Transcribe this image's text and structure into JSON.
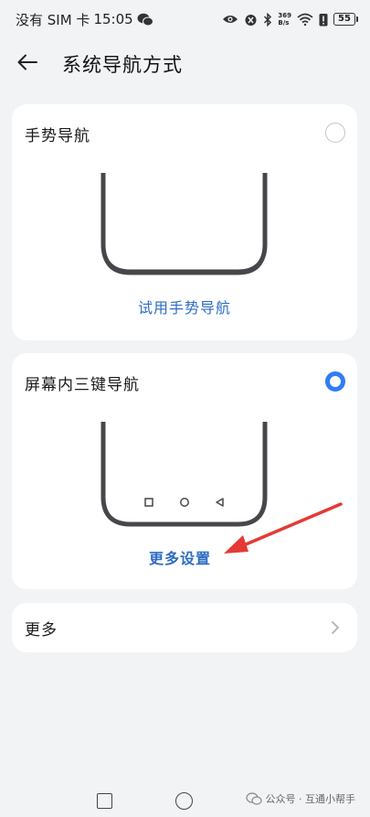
{
  "status_bar": {
    "left_text": "没有 SIM 卡",
    "time": "15:05",
    "net_speed_top": "369",
    "net_speed_bottom": "B/s",
    "battery": "55",
    "icons": [
      "wechat-icon",
      "eye-icon",
      "alarm-icon",
      "bluetooth-icon",
      "wifi-icon",
      "battery-alert-icon"
    ]
  },
  "header": {
    "title": "系统导航方式"
  },
  "options": [
    {
      "title": "手势导航",
      "link": "试用手势导航",
      "selected": false
    },
    {
      "title": "屏幕内三键导航",
      "link": "更多设置",
      "selected": true
    }
  ],
  "more": {
    "label": "更多"
  },
  "watermark": {
    "text": "公众号 · 互通小帮手"
  },
  "colors": {
    "accent": "#2f7df6",
    "link": "#2d6cc2",
    "annotation_arrow": "#e53935",
    "background": "#f1f3f5"
  }
}
